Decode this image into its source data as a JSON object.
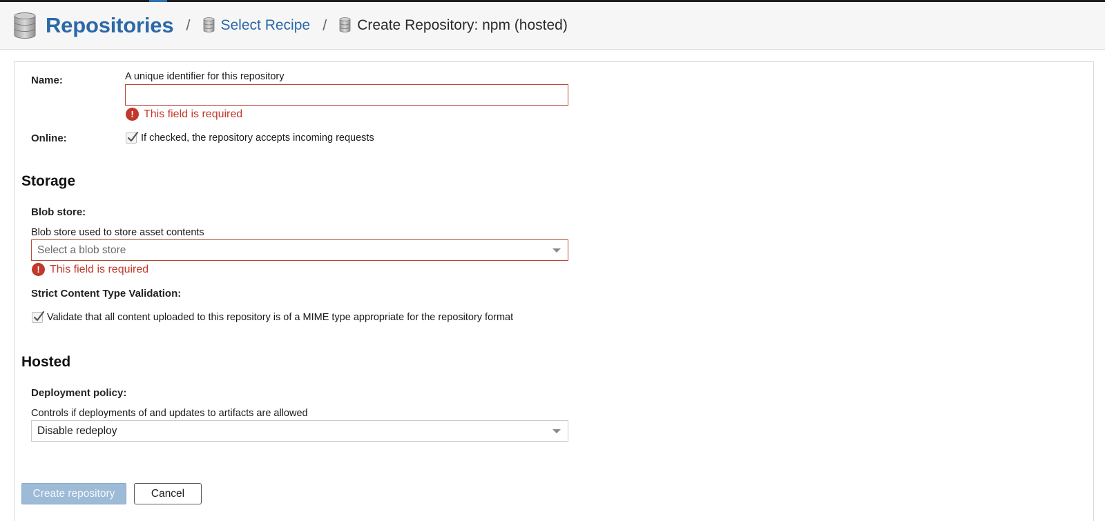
{
  "breadcrumb": {
    "root": "Repositories",
    "separator": "/",
    "middle": "Select Recipe",
    "current": "Create Repository: npm (hosted)"
  },
  "name_field": {
    "label": "Name:",
    "help": "A unique identifier for this repository",
    "value": "",
    "error": "This field is required"
  },
  "online_field": {
    "label": "Online:",
    "checked": true,
    "help": "If checked, the repository accepts incoming requests"
  },
  "storage": {
    "title": "Storage",
    "blob_store": {
      "label": "Blob store:",
      "help": "Blob store used to store asset contents",
      "placeholder": "Select a blob store",
      "error": "This field is required"
    },
    "strict_validation": {
      "label": "Strict Content Type Validation:",
      "checked": true,
      "help": "Validate that all content uploaded to this repository is of a MIME type appropriate for the repository format"
    }
  },
  "hosted": {
    "title": "Hosted",
    "deployment_policy": {
      "label": "Deployment policy:",
      "help": "Controls if deployments of and updates to artifacts are allowed",
      "value": "Disable redeploy"
    }
  },
  "actions": {
    "create_label": "Create repository",
    "cancel_label": "Cancel"
  },
  "colors": {
    "link": "#2b68a8",
    "error": "#c0392b",
    "primary_disabled": "#9dbad6"
  },
  "icons": {
    "database": "database-icon",
    "error": "exclamation-circle-icon",
    "check": "checkmark-icon",
    "caret": "caret-down-icon"
  }
}
